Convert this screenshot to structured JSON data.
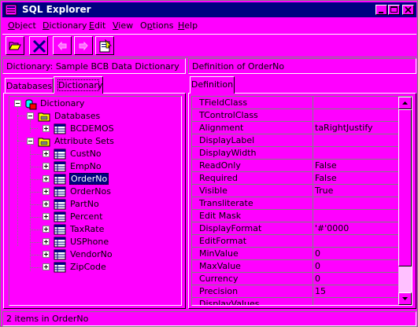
{
  "window": {
    "title": "SQL Explorer",
    "minimize_icon": "minimize-icon",
    "maximize_icon": "maximize-icon",
    "close_icon": "close-icon"
  },
  "menu": [
    {
      "label": "Object",
      "accel": "O"
    },
    {
      "label": "Dictionary",
      "accel": "D"
    },
    {
      "label": "Edit",
      "accel": "E"
    },
    {
      "label": "View",
      "accel": "V"
    },
    {
      "label": "Options",
      "accel": "p"
    },
    {
      "label": "Help",
      "accel": "H"
    }
  ],
  "toolbar": [
    {
      "name": "open-button",
      "icon": "open-folder-icon",
      "enabled": true
    },
    {
      "name": "delete-button",
      "icon": "delete-x-icon",
      "enabled": true
    },
    {
      "name": "undo-button",
      "icon": "undo-icon",
      "enabled": false
    },
    {
      "name": "redo-button",
      "icon": "redo-icon",
      "enabled": false
    },
    {
      "name": "apply-button",
      "icon": "apply-icon",
      "enabled": true
    }
  ],
  "left_header": "Dictionary: Sample BCB Data Dictionary",
  "right_header": "Definition of OrderNo",
  "tabs": {
    "left": [
      "Databases",
      "Dictionary"
    ],
    "left_active": "Dictionary",
    "right": [
      "Definition"
    ]
  },
  "tree": {
    "root": "Dictionary",
    "databases": {
      "label": "Databases",
      "items": [
        "BCDEMOS"
      ]
    },
    "attribute_sets": {
      "label": "Attribute Sets",
      "items": [
        "CustNo",
        "EmpNo",
        "OrderNo",
        "OrderNos",
        "PartNo",
        "Percent",
        "TaxRate",
        "USPhone",
        "VendorNo",
        "ZipCode"
      ],
      "selected": "OrderNo"
    }
  },
  "properties": [
    {
      "name": "TFieldClass",
      "value": ""
    },
    {
      "name": "TControlClass",
      "value": ""
    },
    {
      "name": "Alignment",
      "value": "taRightJustify"
    },
    {
      "name": "DisplayLabel",
      "value": ""
    },
    {
      "name": "DisplayWidth",
      "value": ""
    },
    {
      "name": "ReadOnly",
      "value": "False"
    },
    {
      "name": "Required",
      "value": "False"
    },
    {
      "name": "Visible",
      "value": "True"
    },
    {
      "name": "Transliterate",
      "value": ""
    },
    {
      "name": "Edit Mask",
      "value": ""
    },
    {
      "name": "DisplayFormat",
      "value": "'#'0000"
    },
    {
      "name": "EditFormat",
      "value": ""
    },
    {
      "name": "MinValue",
      "value": "0"
    },
    {
      "name": "MaxValue",
      "value": "0"
    },
    {
      "name": "Currency",
      "value": "0"
    },
    {
      "name": "Precision",
      "value": "15"
    },
    {
      "name": "DisplayValues",
      "value": ""
    }
  ],
  "status": "2 items in OrderNo",
  "colors": {
    "background": "#ff00ff",
    "title_bar": "#000080",
    "selection": "#000080"
  }
}
